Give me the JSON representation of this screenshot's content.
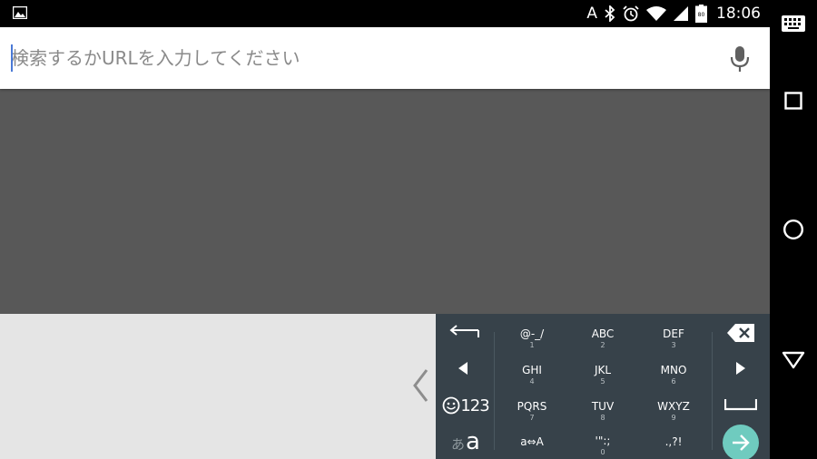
{
  "status_bar": {
    "ime_indicator": "A",
    "time": "18:06",
    "battery_level": "80",
    "icons": [
      "image-icon",
      "bluetooth-icon",
      "alarm-icon",
      "wifi-icon",
      "signal-icon",
      "battery-icon"
    ]
  },
  "search": {
    "placeholder": "検索するかURLを入力してください",
    "value": ""
  },
  "keyboard": {
    "accent_color": "#6fcbbf",
    "keys": [
      {
        "main": "@-_/",
        "sub": "1"
      },
      {
        "main": "ABC",
        "sub": "2"
      },
      {
        "main": "DEF",
        "sub": "3"
      },
      {
        "main": "GHI",
        "sub": "4"
      },
      {
        "main": "JKL",
        "sub": "5"
      },
      {
        "main": "MNO",
        "sub": "6"
      },
      {
        "main": "PQRS",
        "sub": "7"
      },
      {
        "main": "TUV",
        "sub": "8"
      },
      {
        "main": "WXYZ",
        "sub": "9"
      },
      {
        "main": "a⇔A",
        "sub": ""
      },
      {
        "main": "'\":;",
        "sub": "0"
      },
      {
        "main": ".,?!",
        "sub": ""
      }
    ],
    "emoji_key_label": "123",
    "mode_key_kana": "あ",
    "mode_key_alpha": "a"
  },
  "nav": {
    "icons": [
      "keyboard-icon",
      "recents-icon",
      "home-icon",
      "back-icon"
    ]
  }
}
